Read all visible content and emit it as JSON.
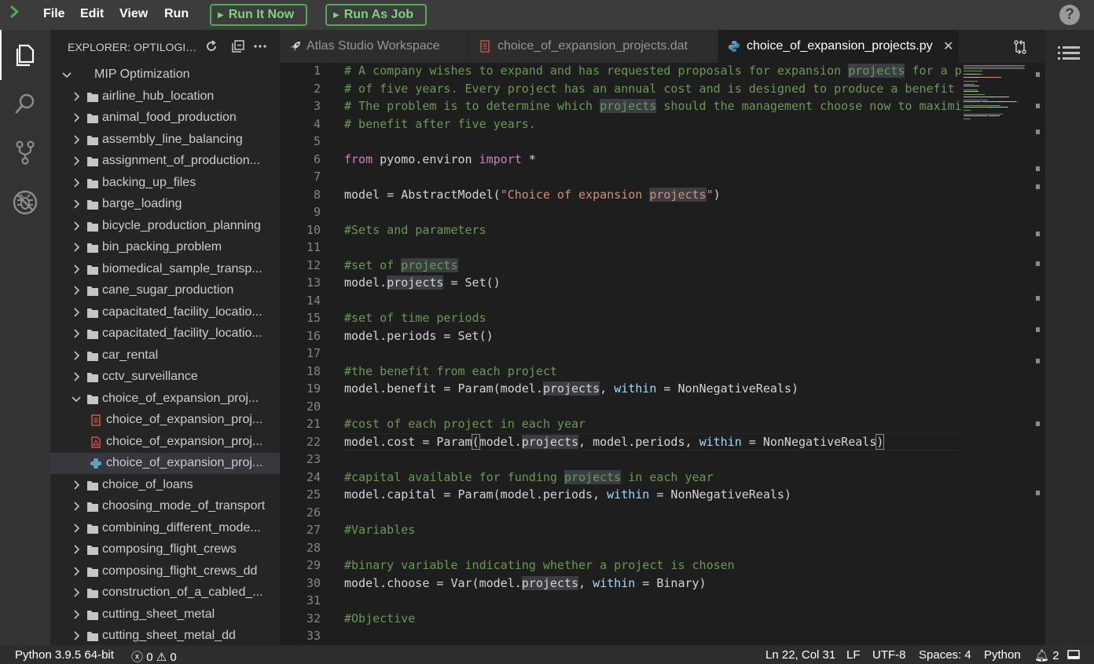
{
  "topbar": {
    "menu": [
      "File",
      "Edit",
      "View",
      "Run"
    ],
    "run_now_label": "Run It Now",
    "run_job_label": "Run As Job",
    "help_glyph": "?"
  },
  "explorer": {
    "title": "EXPLORER: OPTILOGIC...",
    "root_label": "MIP Optimization",
    "folders_before": [
      "airline_hub_location",
      "animal_food_production",
      "assembly_line_balancing",
      "assignment_of_production...",
      "backing_up_files",
      "barge_loading",
      "bicycle_production_planning",
      "bin_packing_problem",
      "biomedical_sample_transp...",
      "cane_sugar_production",
      "capacitated_facility_locatio...",
      "capacitated_facility_locatio...",
      "car_rental",
      "cctv_surveillance"
    ],
    "open_folder_label": "choice_of_expansion_proj...",
    "open_folder_files": [
      {
        "label": "choice_of_expansion_proj...",
        "icon": "data-file-icon",
        "color": "#d35a3a"
      },
      {
        "label": "choice_of_expansion_proj...",
        "icon": "pdf-file-icon",
        "color": "#e04a4a"
      },
      {
        "label": "choice_of_expansion_proj...",
        "icon": "python-file-icon",
        "color": "#5fa0c0"
      }
    ],
    "folders_after": [
      "choice_of_loans",
      "choosing_mode_of_transport",
      "combining_different_mode...",
      "composing_flight_crews",
      "composing_flight_crews_dd",
      "construction_of_a_cabled_...",
      "cutting_sheet_metal",
      "cutting_sheet_metal_dd"
    ]
  },
  "tabs": [
    {
      "label": "Atlas Studio Workspace",
      "icon": "rocket-icon",
      "active": false
    },
    {
      "label": "choice_of_expansion_projects.dat",
      "icon": "data-file-icon",
      "active": false
    },
    {
      "label": "choice_of_expansion_projects.py",
      "icon": "python-file-icon",
      "active": true
    }
  ],
  "editor": {
    "current_line": 22,
    "lines": [
      [
        [
          "cm",
          "# A company wishes to expand and has requested proposals for expansion "
        ],
        [
          "cmhl",
          "projects"
        ],
        [
          "cm",
          " for a p"
        ]
      ],
      [
        [
          "cm",
          "# of five years. Every project has an annual cost and is designed to produce a benefit"
        ]
      ],
      [
        [
          "cm",
          "# The problem is to determine which "
        ],
        [
          "cmhl",
          "projects"
        ],
        [
          "cm",
          " should the management choose now to maximi"
        ]
      ],
      [
        [
          "cm",
          "# benefit after five years."
        ]
      ],
      [],
      [
        [
          "kw",
          "from"
        ],
        [
          "pl",
          " pyomo.environ "
        ],
        [
          "kw",
          "import"
        ],
        [
          "pl",
          " *"
        ]
      ],
      [],
      [
        [
          "pl",
          "model = AbstractModel("
        ],
        [
          "str",
          "\"Choice of expansion "
        ],
        [
          "strhl",
          "projects"
        ],
        [
          "str",
          "\""
        ],
        [
          "pl",
          ")"
        ]
      ],
      [],
      [
        [
          "cm",
          "#Sets and parameters"
        ]
      ],
      [],
      [
        [
          "cm",
          "#set of "
        ],
        [
          "cmhl",
          "projects"
        ]
      ],
      [
        [
          "pl",
          "model."
        ],
        [
          "plhl",
          "projects"
        ],
        [
          "pl",
          " = Set()"
        ]
      ],
      [],
      [
        [
          "cm",
          "#set of time periods"
        ]
      ],
      [
        [
          "pl",
          "model.periods = Set()"
        ]
      ],
      [],
      [
        [
          "cm",
          "#the benefit from each project"
        ]
      ],
      [
        [
          "pl",
          "model.benefit = Param(model."
        ],
        [
          "plhl",
          "projects"
        ],
        [
          "pl",
          ", "
        ],
        [
          "id",
          "within"
        ],
        [
          "pl",
          " = NonNegativeReals)"
        ]
      ],
      [],
      [
        [
          "cm",
          "#cost of each project in each year"
        ]
      ],
      [
        [
          "pl",
          "model.cost = Param"
        ],
        [
          "br",
          "("
        ],
        [
          "pl",
          "model."
        ],
        [
          "plhl",
          "projects"
        ],
        [
          "pl",
          ", model.periods, "
        ],
        [
          "id",
          "within"
        ],
        [
          "pl",
          " = NonNegativeReals"
        ],
        [
          "br",
          ")"
        ]
      ],
      [],
      [
        [
          "cm",
          "#capital available for funding "
        ],
        [
          "cmhl",
          "projects"
        ],
        [
          "cm",
          " in each year"
        ]
      ],
      [
        [
          "pl",
          "model.capital = Param(model.periods, "
        ],
        [
          "id",
          "within"
        ],
        [
          "pl",
          " = NonNegativeReals)"
        ]
      ],
      [],
      [
        [
          "cm",
          "#Variables"
        ]
      ],
      [],
      [
        [
          "cm",
          "#binary variable indicating whether a project is chosen"
        ]
      ],
      [
        [
          "pl",
          "model.choose = Var(model."
        ],
        [
          "plhl",
          "projects"
        ],
        [
          "pl",
          ", "
        ],
        [
          "id",
          "within"
        ],
        [
          "pl",
          " = Binary)"
        ]
      ],
      [],
      [
        [
          "cm",
          "#Objective"
        ]
      ],
      []
    ]
  },
  "status": {
    "interpreter": "Python 3.9.5 64-bit",
    "errors": "0",
    "warnings": "0",
    "position": "Ln 22, Col 31",
    "eol": "LF",
    "encoding": "UTF-8",
    "indent": "Spaces: 4",
    "language": "Python",
    "notifications": "2"
  },
  "colors": {
    "accent_green": "#4caf50",
    "comment": "#6a9955",
    "keyword": "#c586c0",
    "string": "#ce9178",
    "identifier": "#9cdcfe"
  }
}
